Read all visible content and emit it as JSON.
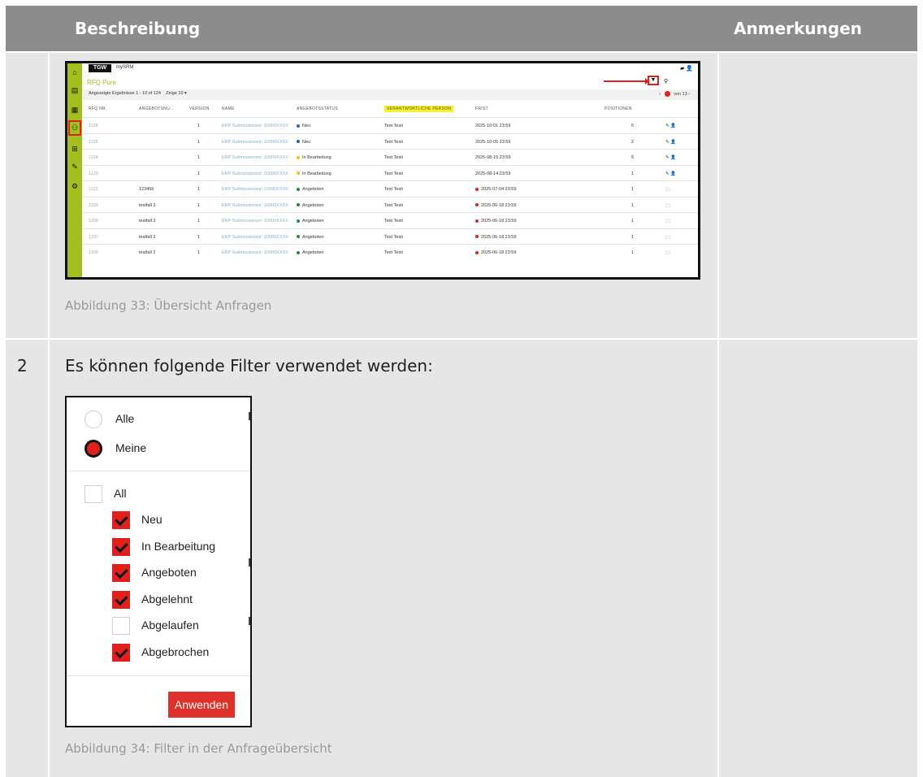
{
  "header": {
    "col_description": "Beschreibung",
    "col_notes": "Anmerkungen"
  },
  "row1": {
    "number": "",
    "caption": "Abbildung 33: Übersicht Anfragen",
    "screenshot": {
      "logo": "TGW",
      "app_name": "mySRM",
      "page_title": "RFQ Pure",
      "results_text": "Angezeigte Ergebnisse 1 - 10 of 124",
      "show_label": "Zeige",
      "show_value": "10",
      "pagination": "von 13",
      "columns": [
        "RFQ NR.",
        "ANGEBOTSNU...",
        "VERSION",
        "NAME",
        "ANGEBOTSSTATUS",
        "VERANTWORTLICHE PERSON",
        "FRIST",
        "POSITIONEN"
      ],
      "rows": [
        {
          "rfq": "1126",
          "offer": "",
          "version": "1",
          "name": "ERP Submissionsnr: 10000XXXX",
          "status": "Neu",
          "status_color": "#2f5fa8",
          "person": "Test Testi",
          "deadline": "2025-10-01 23:59",
          "overdue": false,
          "positions": "5",
          "actions": "✎ 👤"
        },
        {
          "rfq": "1125",
          "offer": "",
          "version": "1",
          "name": "ERP Submissionsnr: 10000XXXX",
          "status": "Neu",
          "status_color": "#2f5fa8",
          "person": "Test Testi",
          "deadline": "2025-10-05 23:59",
          "overdue": false,
          "positions": "2",
          "actions": "✎ 👤"
        },
        {
          "rfq": "1124",
          "offer": "",
          "version": "1",
          "name": "ERP Submissionsnr: 10000XXXX",
          "status": "In Bearbeitung",
          "status_color": "#f2c21a",
          "person": "Test Testi",
          "deadline": "2025-08-15 23:59",
          "overdue": false,
          "positions": "5",
          "actions": "✎ 👤"
        },
        {
          "rfq": "1123",
          "offer": "",
          "version": "1",
          "name": "ERP Submissionsnr: 10000XXXX",
          "status": "In Bearbeitung",
          "status_color": "#f2c21a",
          "person": "Test Testi",
          "deadline": "2025-08-14 23:59",
          "overdue": false,
          "positions": "1",
          "actions": "✎ 👤"
        },
        {
          "rfq": "1121",
          "offer": "123456",
          "version": "1",
          "name": "ERP Submissionsnr: 10000XXXX",
          "status": "Angeboten",
          "status_color": "#1f8a3a",
          "person": "Test Testi",
          "deadline": "2025-07-04 23:59",
          "overdue": true,
          "positions": "1",
          "actions": "🗀"
        },
        {
          "rfq": "1109",
          "offer": "testfall 3",
          "version": "1",
          "name": "ERP Submissionsnr: 10000XXXX",
          "status": "Angeboten",
          "status_color": "#1f8a3a",
          "person": "Test Testi",
          "deadline": "2025-06-18 23:59",
          "overdue": true,
          "positions": "1",
          "actions": "🗀"
        },
        {
          "rfq": "1108",
          "offer": "testfall 3",
          "version": "1",
          "name": "ERP Submissionsnr: 10000XXXX",
          "status": "Angeboten",
          "status_color": "#1f8a3a",
          "person": "Test Testi",
          "deadline": "2025-06-18 23:59",
          "overdue": true,
          "positions": "1",
          "actions": "🗀"
        },
        {
          "rfq": "1107",
          "offer": "testfall 3",
          "version": "1",
          "name": "ERP Submissionsnr: 10000XXXX",
          "status": "Angeboten",
          "status_color": "#1f8a3a",
          "person": "Test Testi",
          "deadline": "2025-06-18 23:59",
          "overdue": true,
          "positions": "1",
          "actions": "🗀"
        },
        {
          "rfq": "1106",
          "offer": "testfall 2",
          "version": "1",
          "name": "ERP Submissionsnr: 10000XXXX",
          "status": "Angeboten",
          "status_color": "#1f8a3a",
          "person": "Test Testi",
          "deadline": "2025-06-18 23:59",
          "overdue": true,
          "positions": "1",
          "actions": "🗀"
        }
      ]
    }
  },
  "row2": {
    "number": "2",
    "intro": "Es können folgende Filter verwendet werden:",
    "caption": "Abbildung 34: Filter in der Anfrageübersicht",
    "filter": {
      "radio_all": "Alle",
      "radio_mine": "Meine",
      "selected_radio": "Meine",
      "check_all": "All",
      "statuses": [
        {
          "label": "Neu",
          "checked": true
        },
        {
          "label": "In Bearbeitung",
          "checked": true
        },
        {
          "label": "Angeboten",
          "checked": true
        },
        {
          "label": "Abgelehnt",
          "checked": true
        },
        {
          "label": "Abgelaufen",
          "checked": false
        },
        {
          "label": "Abgebrochen",
          "checked": true
        }
      ],
      "apply_label": "Anwenden"
    }
  },
  "colors": {
    "accent": "#a3bf1f",
    "highlight_red": "#e0201c",
    "header_bg": "#8c8c8c",
    "cell_bg": "#e6e6e6"
  }
}
